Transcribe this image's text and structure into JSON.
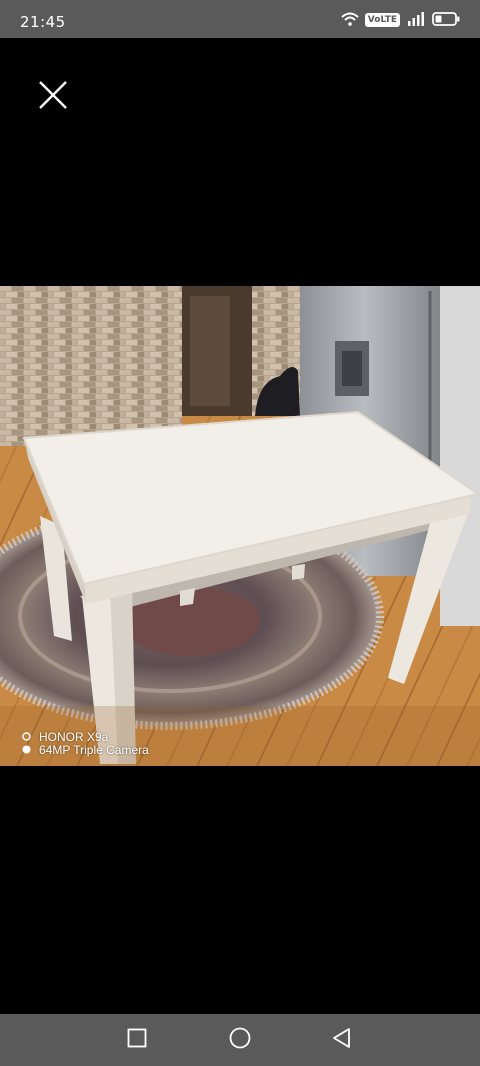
{
  "status_bar": {
    "time": "21:45",
    "volte": "VoLTE",
    "icons": [
      "wifi-icon",
      "volte-badge",
      "signal-icon",
      "battery-icon"
    ]
  },
  "viewer": {
    "close_icon": "close-icon",
    "photo_watermark": {
      "line1": "HONOR X9a",
      "line2": "64MP Triple Camera"
    }
  },
  "nav_bar": {
    "icons": [
      "recents-square-icon",
      "home-circle-icon",
      "back-triangle-icon"
    ]
  },
  "colors": {
    "system_bars": "#5a5a5a",
    "background": "#000000",
    "icon": "#ffffff"
  }
}
